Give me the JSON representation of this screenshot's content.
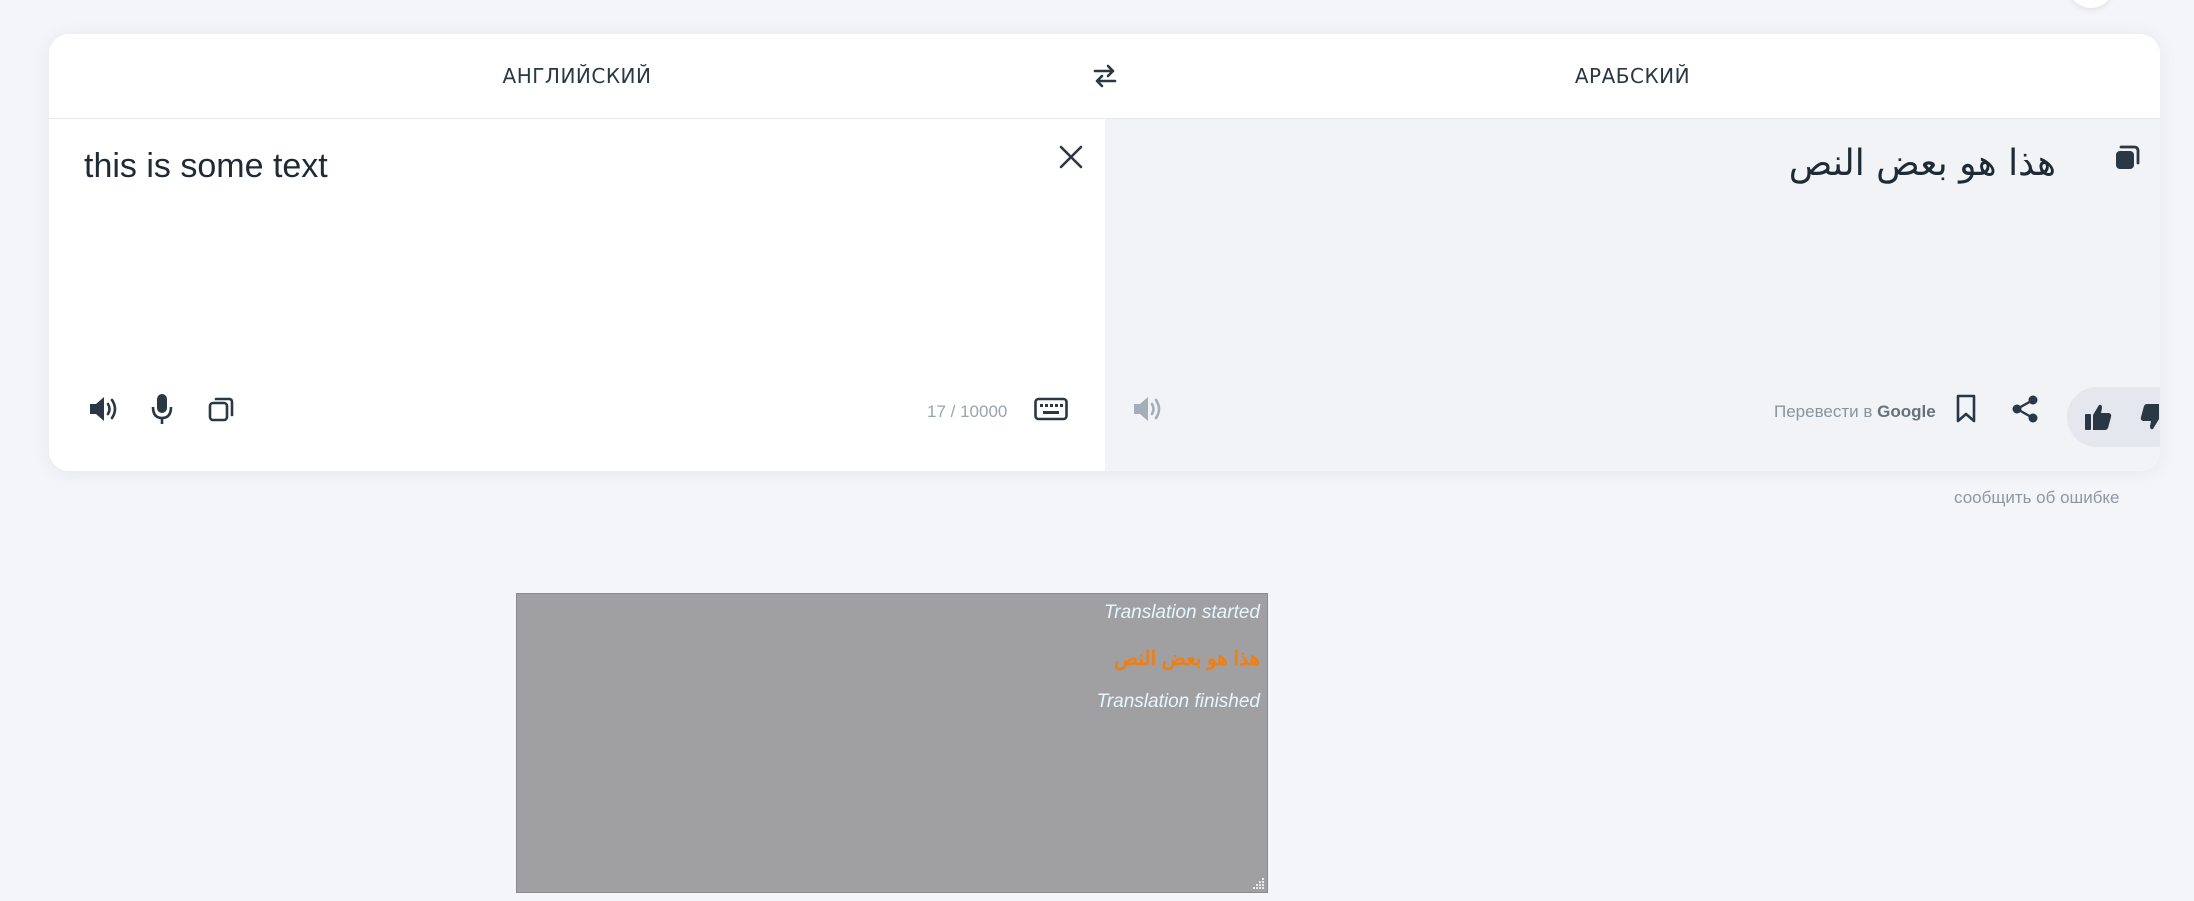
{
  "header": {
    "source_lang": "АНГЛИЙСКИЙ",
    "target_lang": "АРАБСКИЙ",
    "swap_icon": "swap-arrows-icon"
  },
  "source": {
    "text": "this is some text",
    "char_count": "17 / 10000",
    "icons": [
      "speaker-icon",
      "microphone-icon",
      "copy-icon",
      "close-icon",
      "keyboard-icon"
    ]
  },
  "target": {
    "text": "هذا هو بعض النص",
    "google_prefix": "Перевести в",
    "google_brand": "Google",
    "icons": [
      "copy-icon",
      "speaker-icon",
      "bookmark-icon",
      "share-icon",
      "thumbs-up-icon",
      "thumbs-down-icon"
    ]
  },
  "footer": {
    "report_link": "сообщить об ошибке"
  },
  "log": {
    "lines": [
      "Translation started",
      "هذا هو بعض النص",
      "Translation finished"
    ],
    "colors": {
      "status": "#e6f6ff",
      "result": "#f07f12",
      "background": "#a0a0a2"
    }
  }
}
